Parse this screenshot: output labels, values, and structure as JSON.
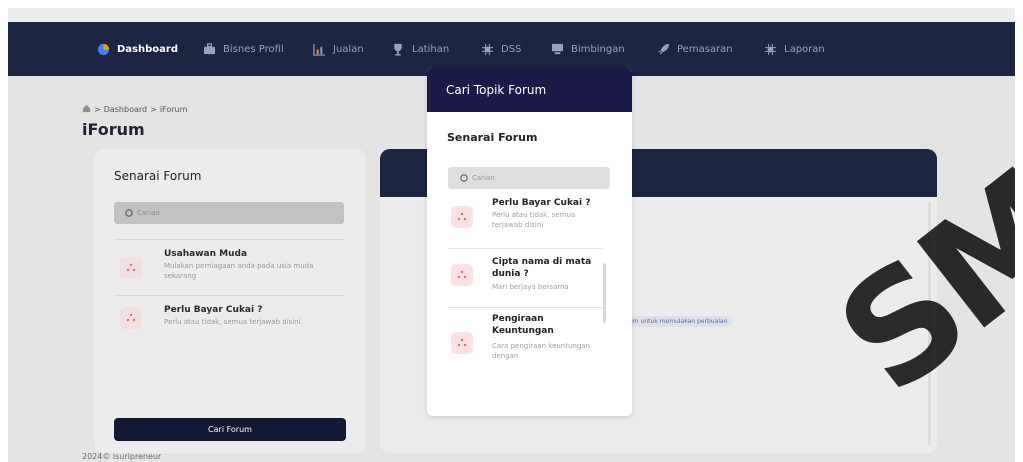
{
  "navbar": {
    "items": [
      {
        "label": "Dashboard",
        "icon": "pie-chart-icon",
        "active": true
      },
      {
        "label": "Bisnes Profil",
        "icon": "briefcase-icon",
        "active": false
      },
      {
        "label": "Jualan",
        "icon": "bar-chart-icon",
        "active": false
      },
      {
        "label": "Latihan",
        "icon": "trophy-icon",
        "active": false
      },
      {
        "label": "DSS",
        "icon": "chip-icon",
        "active": false
      },
      {
        "label": "Bimbingan",
        "icon": "monitor-icon",
        "active": false
      },
      {
        "label": "Pemasaran",
        "icon": "rocket-icon",
        "active": false
      },
      {
        "label": "Laporan",
        "icon": "chip-icon",
        "active": false
      }
    ]
  },
  "breadcrumb": {
    "home": "Dashboard",
    "current": "iForum",
    "separator": ">"
  },
  "page": {
    "title": "iForum"
  },
  "left_panel": {
    "title": "Senarai Forum",
    "search_placeholder": "Carian",
    "items": [
      {
        "title": "Usahawan Muda",
        "description": "Mulakan perniagaan anda pada usia muda sekarang"
      },
      {
        "title": "Perlu Bayar Cukai ?",
        "description": "Perlu atau tidak, semua terjawab disini"
      }
    ],
    "button_label": "Cari Forum"
  },
  "right_panel": {
    "hint": "um untuk memulakan perbualan"
  },
  "footer": {
    "text": "2024© isuripreneur"
  },
  "watermark": {
    "text": "SM"
  },
  "modal": {
    "title": "Cari Topik Forum",
    "subtitle": "Senarai Forum",
    "search_placeholder": "Carian",
    "items": [
      {
        "title": "Perlu Bayar Cukai ?",
        "description": "Perlu atau tidak, semua terjawab disini"
      },
      {
        "title": "Cipta nama di mata dunia ?",
        "description": "Mari berjaya bersama"
      },
      {
        "title": "Pengiraan Keuntungan",
        "description": "Cara pengiraan keuntungan dengan"
      }
    ]
  },
  "colors": {
    "navbar": "#1c2541",
    "modal_header": "#1c1a47",
    "icon_bg": "#fbe1e3",
    "accent_red": "#e06a7a"
  }
}
